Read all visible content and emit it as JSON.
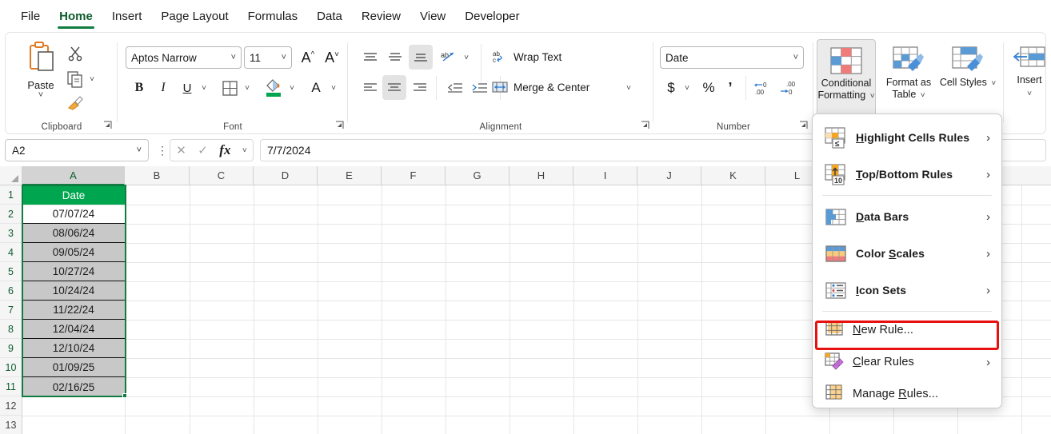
{
  "tabs": [
    {
      "label": "File",
      "active": false
    },
    {
      "label": "Home",
      "active": true
    },
    {
      "label": "Insert",
      "active": false
    },
    {
      "label": "Page Layout",
      "active": false
    },
    {
      "label": "Formulas",
      "active": false
    },
    {
      "label": "Data",
      "active": false
    },
    {
      "label": "Review",
      "active": false
    },
    {
      "label": "View",
      "active": false
    },
    {
      "label": "Developer",
      "active": false
    }
  ],
  "ribbon": {
    "groups": {
      "clipboard": {
        "label": "Clipboard",
        "paste_label": "Paste"
      },
      "font": {
        "label": "Font",
        "font_name": "Aptos Narrow",
        "font_size": "11",
        "bold": "B",
        "italic": "I",
        "underline": "U",
        "grow_font": "A",
        "shrink_font": "A"
      },
      "alignment": {
        "label": "Alignment",
        "wrap_text": "Wrap Text",
        "merge_center": "Merge & Center"
      },
      "number": {
        "label": "Number",
        "format": "Date",
        "currency": "$",
        "percent": "%",
        "comma": " ,",
        "increase_decimal": ".00",
        "decrease_decimal": ".00"
      },
      "styles": {
        "conditional_formatting": "Conditional Formatting",
        "format_as_table": "Format as Table",
        "cell_styles": "Cell Styles"
      },
      "cells": {
        "insert": "Insert"
      }
    }
  },
  "formula_bar": {
    "name_box": "A2",
    "cancel_icon": "✕",
    "enter_icon": "✓",
    "function_icon": "fx",
    "formula_value": "7/7/2024"
  },
  "sheet": {
    "columns": [
      "A",
      "B",
      "C",
      "D",
      "E",
      "F",
      "G",
      "H",
      "I",
      "J",
      "K",
      "L"
    ],
    "rows": [
      "1",
      "2",
      "3",
      "4",
      "5",
      "6",
      "7",
      "8",
      "9",
      "10",
      "11",
      "12",
      "13"
    ],
    "selected_column": "A",
    "header_cell": "Date",
    "header_bg": "#00a64f",
    "header_fg": "#ffffff",
    "data_bg": "#c8c8c8",
    "column_a_values": [
      "07/07/24",
      "08/06/24",
      "09/05/24",
      "10/27/24",
      "10/24/24",
      "11/22/24",
      "12/04/24",
      "12/10/24",
      "01/09/25",
      "02/16/25"
    ],
    "active_cell": "A2",
    "selection_color": "#107c41"
  },
  "menu": {
    "items": [
      {
        "label": "Highlight Cells Rules",
        "icon": "highlight-cells-rules-icon",
        "submenu": true,
        "accel": "H"
      },
      {
        "label": "Top/Bottom Rules",
        "icon": "top-bottom-rules-icon",
        "submenu": true,
        "accel": "T"
      },
      {
        "label": "Data Bars",
        "icon": "data-bars-icon",
        "submenu": true,
        "accel": "D"
      },
      {
        "label": "Color Scales",
        "icon": "color-scales-icon",
        "submenu": true,
        "accel": "S"
      },
      {
        "label": "Icon Sets",
        "icon": "icon-sets-icon",
        "submenu": true,
        "accel": "I"
      },
      {
        "label": "New Rule...",
        "icon": "new-rule-icon",
        "submenu": false,
        "accel": "N"
      },
      {
        "label": "Clear Rules",
        "icon": "clear-rules-icon",
        "submenu": true,
        "accel": "C"
      },
      {
        "label": "Manage Rules...",
        "icon": "manage-rules-icon",
        "submenu": false,
        "accel": "R"
      }
    ],
    "highlight_item": "New Rule...",
    "highlight_color": "#e81111",
    "arrow": "›"
  }
}
